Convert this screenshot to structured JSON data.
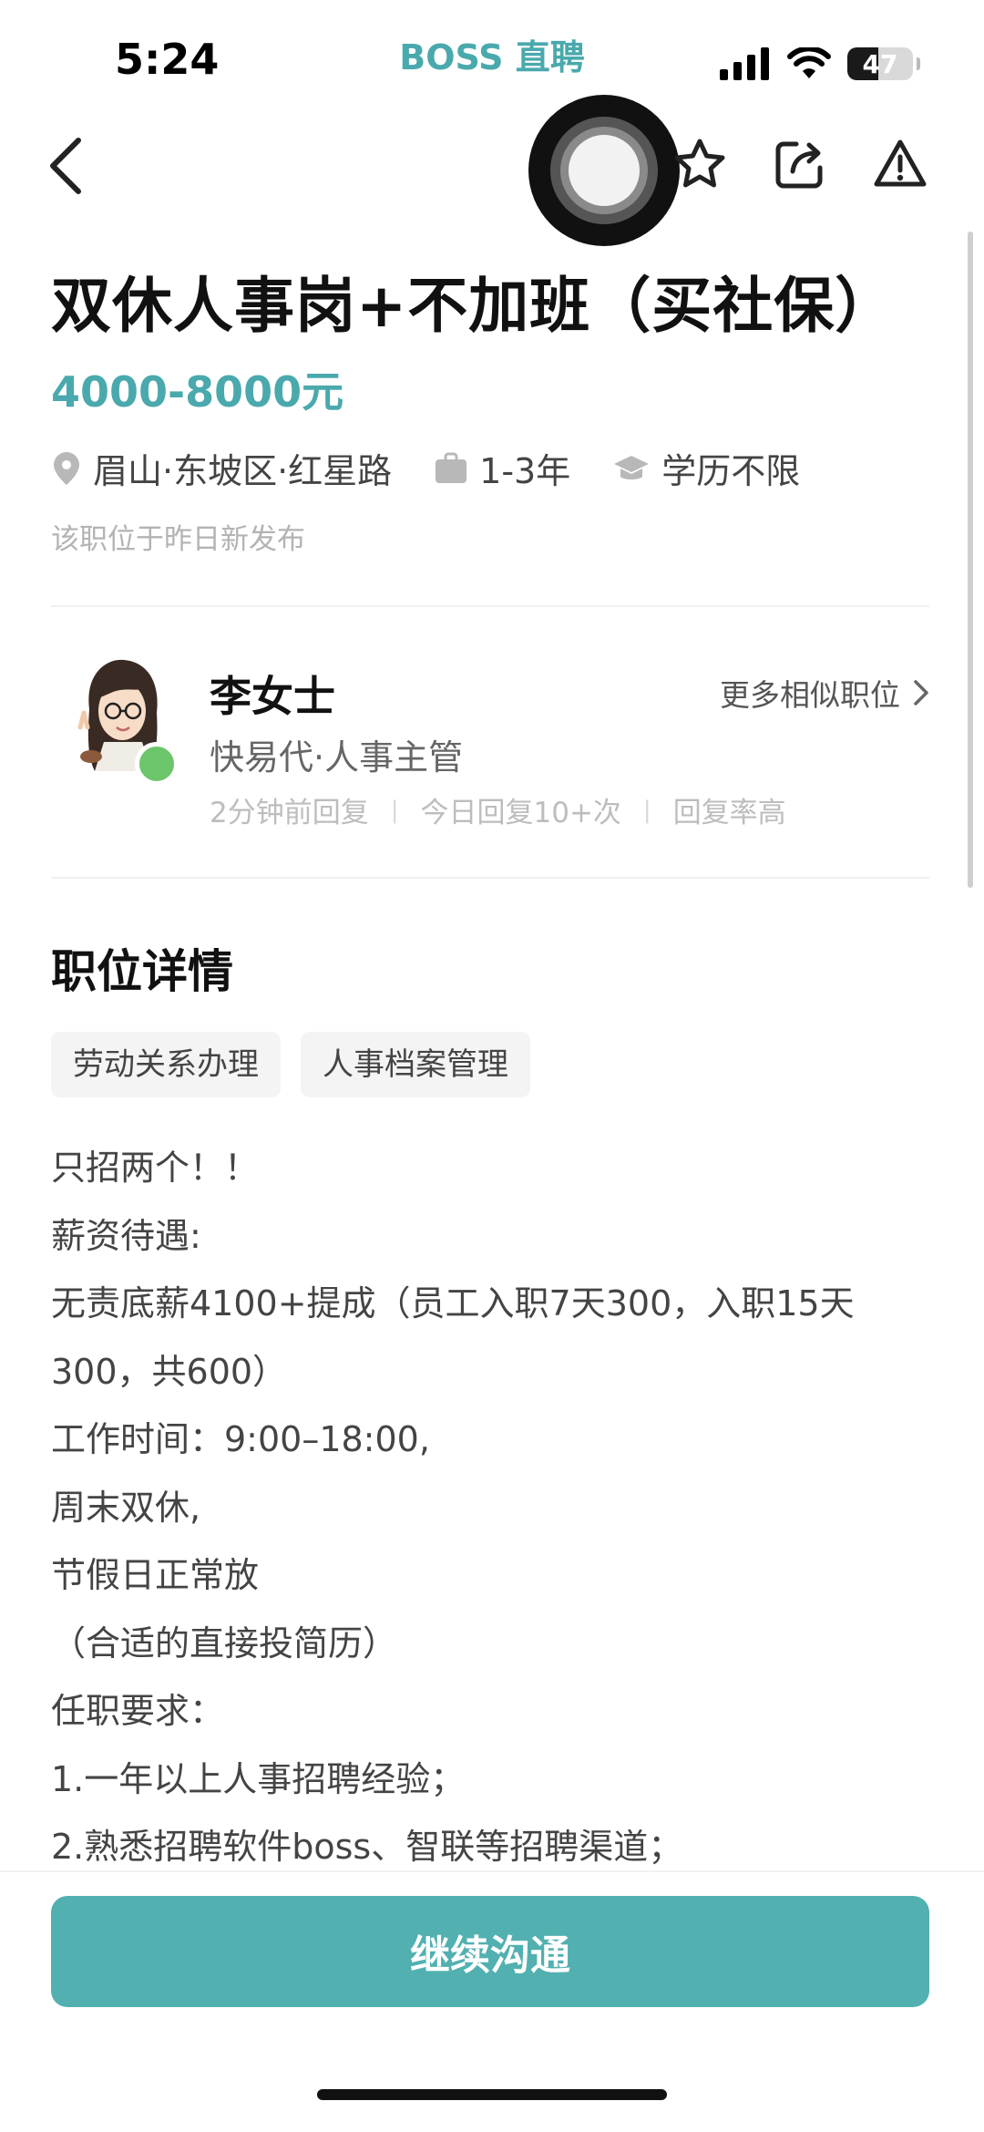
{
  "status_bar": {
    "time": "5:24",
    "app_name": "BOSS 直聘",
    "battery": "47"
  },
  "nav": {
    "icons": [
      "back-icon",
      "assistive-touch",
      "star-icon",
      "share-icon",
      "warning-icon"
    ]
  },
  "job": {
    "title": "双休人事岗+不加班（买社保）",
    "salary": "4000-8000元",
    "location": "眉山·东坡区·红星路",
    "experience": "1-3年",
    "education": "学历不限",
    "posted": "该职位于昨日新发布"
  },
  "recruiter": {
    "name": "李女士",
    "company_role": "快易代·人事主管",
    "stats": [
      "2分钟前回复",
      "今日回复10+次",
      "回复率高"
    ],
    "more_link": "更多相似职位"
  },
  "details": {
    "section_title": "职位详情",
    "tags": [
      "劳动关系办理",
      "人事档案管理"
    ],
    "lines": [
      "只招两个！！",
      "薪资待遇:",
      "无责底薪4100+提成（员工入职7天300，入职15天",
      "300，共600）",
      "工作时间：9:00–18:00,",
      "周末双休,",
      "节假日正常放",
      "（合适的直接投简历）",
      "任职要求：",
      "1.一年以上人事招聘经验；",
      "2.熟悉招聘软件boss、智联等招聘渠道；"
    ]
  },
  "bottom": {
    "cta_label": "继续沟通"
  },
  "colors": {
    "accent": "#4aa9ad",
    "cta": "#52b0b0",
    "online": "#6cc56a"
  }
}
